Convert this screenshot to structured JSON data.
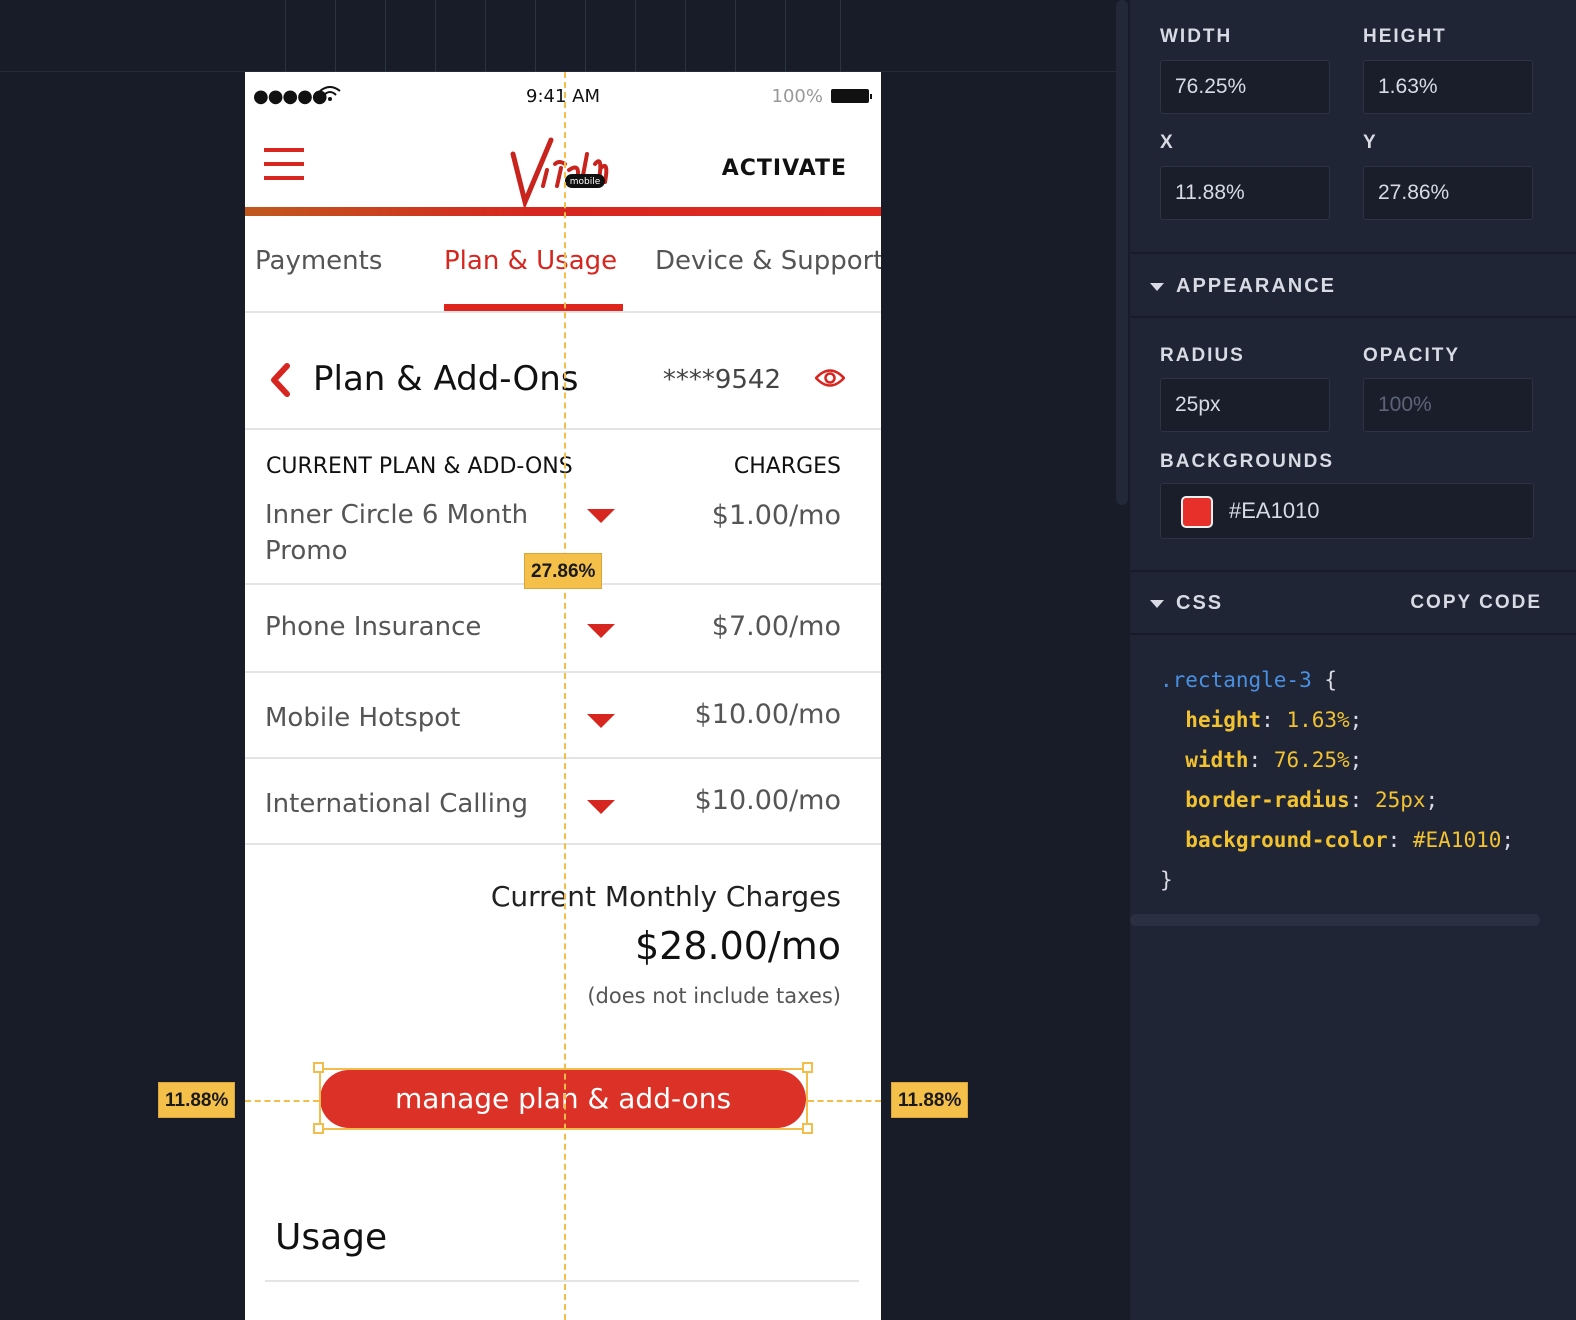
{
  "phone": {
    "status": {
      "signal": "●●●●●",
      "time": "9:41 AM",
      "battery": "100%"
    },
    "header": {
      "activate_label": "ACTIVATE",
      "logo_text": "Virgin",
      "logo_sub": "mobile"
    },
    "tabs": [
      {
        "label": "Payments"
      },
      {
        "label": "Plan & Usage",
        "active": true
      },
      {
        "label": "Device & Support"
      }
    ],
    "section": {
      "title": "Plan & Add-Ons",
      "account": "****9542"
    },
    "table": {
      "col_plan": "CURRENT PLAN & ADD-ONS",
      "col_charges": "CHARGES",
      "rows": [
        {
          "name": "Inner Circle 6 Month Promo",
          "charge": "$1.00/mo"
        },
        {
          "name": "Phone Insurance",
          "charge": "$7.00/mo"
        },
        {
          "name": "Mobile Hotspot",
          "charge": "$10.00/mo"
        },
        {
          "name": "International Calling",
          "charge": "$10.00/mo"
        }
      ]
    },
    "totals": {
      "label": "Current Monthly Charges",
      "amount": "$28.00/mo",
      "note": "(does not include taxes)"
    },
    "manage_button": "manage plan & add-ons",
    "usage_title": "Usage"
  },
  "guides": {
    "top_badge": "27.86%",
    "left_badge": "11.88%",
    "right_badge": "11.88%"
  },
  "inspector": {
    "width_label": "WIDTH",
    "width_value": "76.25%",
    "height_label": "HEIGHT",
    "height_value": "1.63%",
    "x_label": "X",
    "x_value": "11.88%",
    "y_label": "Y",
    "y_value": "27.86%",
    "appearance_label": "APPEARANCE",
    "radius_label": "RADIUS",
    "radius_value": "25px",
    "opacity_label": "OPACITY",
    "opacity_placeholder": "100%",
    "backgrounds_label": "BACKGROUNDS",
    "background_color": "#EA1010",
    "background_hex": "#EA1010",
    "css_label": "CSS",
    "copy_code_label": "COPY CODE",
    "css": {
      "selector": ".rectangle-3",
      "open": " {",
      "close": "}",
      "decls": [
        {
          "prop": "height",
          "val": "1.63%"
        },
        {
          "prop": "width",
          "val": "76.25%"
        },
        {
          "prop": "border-radius",
          "val": "25px"
        },
        {
          "prop": "background-color",
          "val": "#EA1010"
        }
      ]
    }
  },
  "colors": {
    "brand_red": "#dc3126",
    "guide_yellow": "#f2bd4a",
    "canvas_bg": "#181c28",
    "panel_bg": "#1f2535"
  }
}
